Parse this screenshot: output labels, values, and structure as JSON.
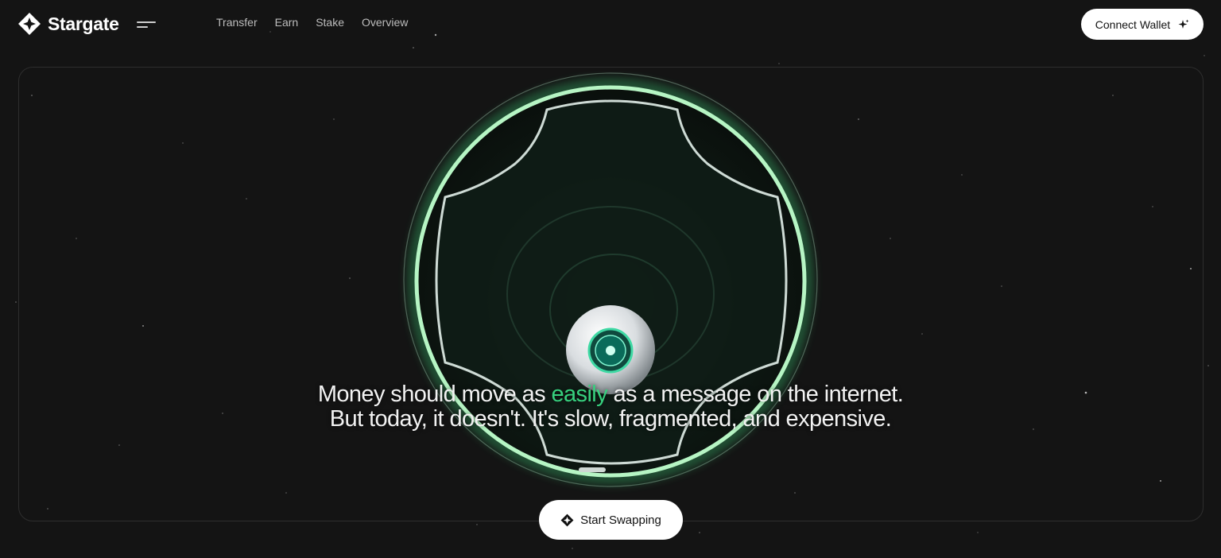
{
  "brand": {
    "name": "Stargate",
    "logo_icon": "stargate-diamond-icon"
  },
  "header": {
    "menu_icon": "menu-lines-icon",
    "nav": [
      {
        "label": "Transfer"
      },
      {
        "label": "Earn"
      },
      {
        "label": "Stake"
      },
      {
        "label": "Overview"
      }
    ],
    "connect_wallet": {
      "label": "Connect Wallet",
      "icon": "sparkle-icon"
    }
  },
  "hero": {
    "headline_before": "Money should move as ",
    "headline_accent": "easily",
    "headline_after": " as a message on the internet. But today, it doesn't. It's slow, fragmented, and expensive.",
    "cta": {
      "label": "Start Swapping",
      "icon": "stargate-diamond-icon"
    }
  },
  "colors": {
    "background": "#141414",
    "accent_green": "#37d07e",
    "ring_green": "#a8f0b8",
    "button_bg": "#ffffff"
  }
}
